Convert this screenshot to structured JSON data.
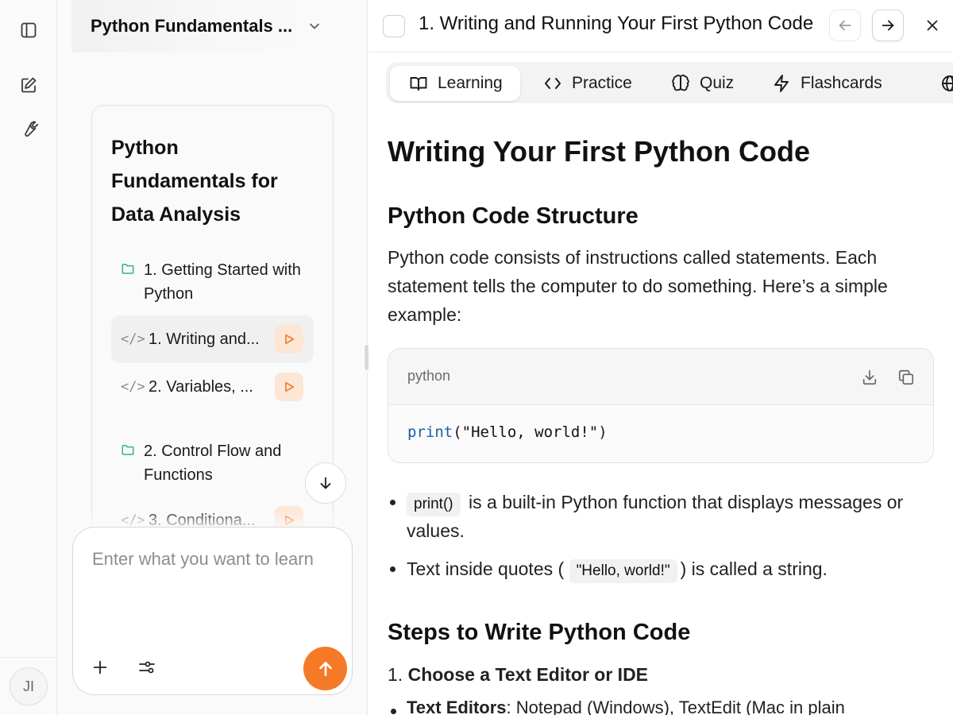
{
  "rail": {
    "avatar_initials": "JI"
  },
  "course": {
    "header_title": "Python Fundamentals ...",
    "outline_title": "Python Fundamentals for Data Analysis",
    "modules": [
      {
        "label": "1. Getting Started with Python"
      },
      {
        "label": "2. Control Flow and Functions"
      }
    ],
    "lessons": [
      {
        "label": "1. Writing and...",
        "active": true
      },
      {
        "label": "2. Variables, ..."
      },
      {
        "label": "3. Conditiona..."
      }
    ]
  },
  "chat": {
    "placeholder": "Enter what you want to learn"
  },
  "lesson_view": {
    "title": "1. Writing and Running Your First Python Code",
    "tabs": [
      {
        "label": "Learning",
        "icon": "book-open-icon",
        "active": true
      },
      {
        "label": "Practice",
        "icon": "code-icon"
      },
      {
        "label": "Quiz",
        "icon": "brain-icon"
      },
      {
        "label": "Flashcards",
        "icon": "zap-icon"
      }
    ],
    "heading": "Writing Your First Python Code",
    "section1_heading": "Python Code Structure",
    "section1_paragraph": "Python code consists of instructions called statements. Each statement tells the computer to do something. Here’s a simple example:",
    "code": {
      "language": "python",
      "fn": "print",
      "open": "(",
      "str": "\"Hello, world!\"",
      "close": ")"
    },
    "bullets": [
      {
        "code": "print()",
        "text": " is a built-in Python function that displays messages or values."
      },
      {
        "prefix": "Text inside quotes ( ",
        "code": "\"Hello, world!\"",
        "text": ") is called a string."
      }
    ],
    "section2_heading": "Steps to Write Python Code",
    "step1_number": "1. ",
    "step1_label": "Choose a Text Editor or IDE",
    "substep_label": "Text Editors",
    "substep_text": ": Notepad (Windows), TextEdit (Mac in plain"
  },
  "colors": {
    "accent": "#f47a27",
    "folder": "#2fb87a",
    "code_fn": "#1a5fa8"
  }
}
